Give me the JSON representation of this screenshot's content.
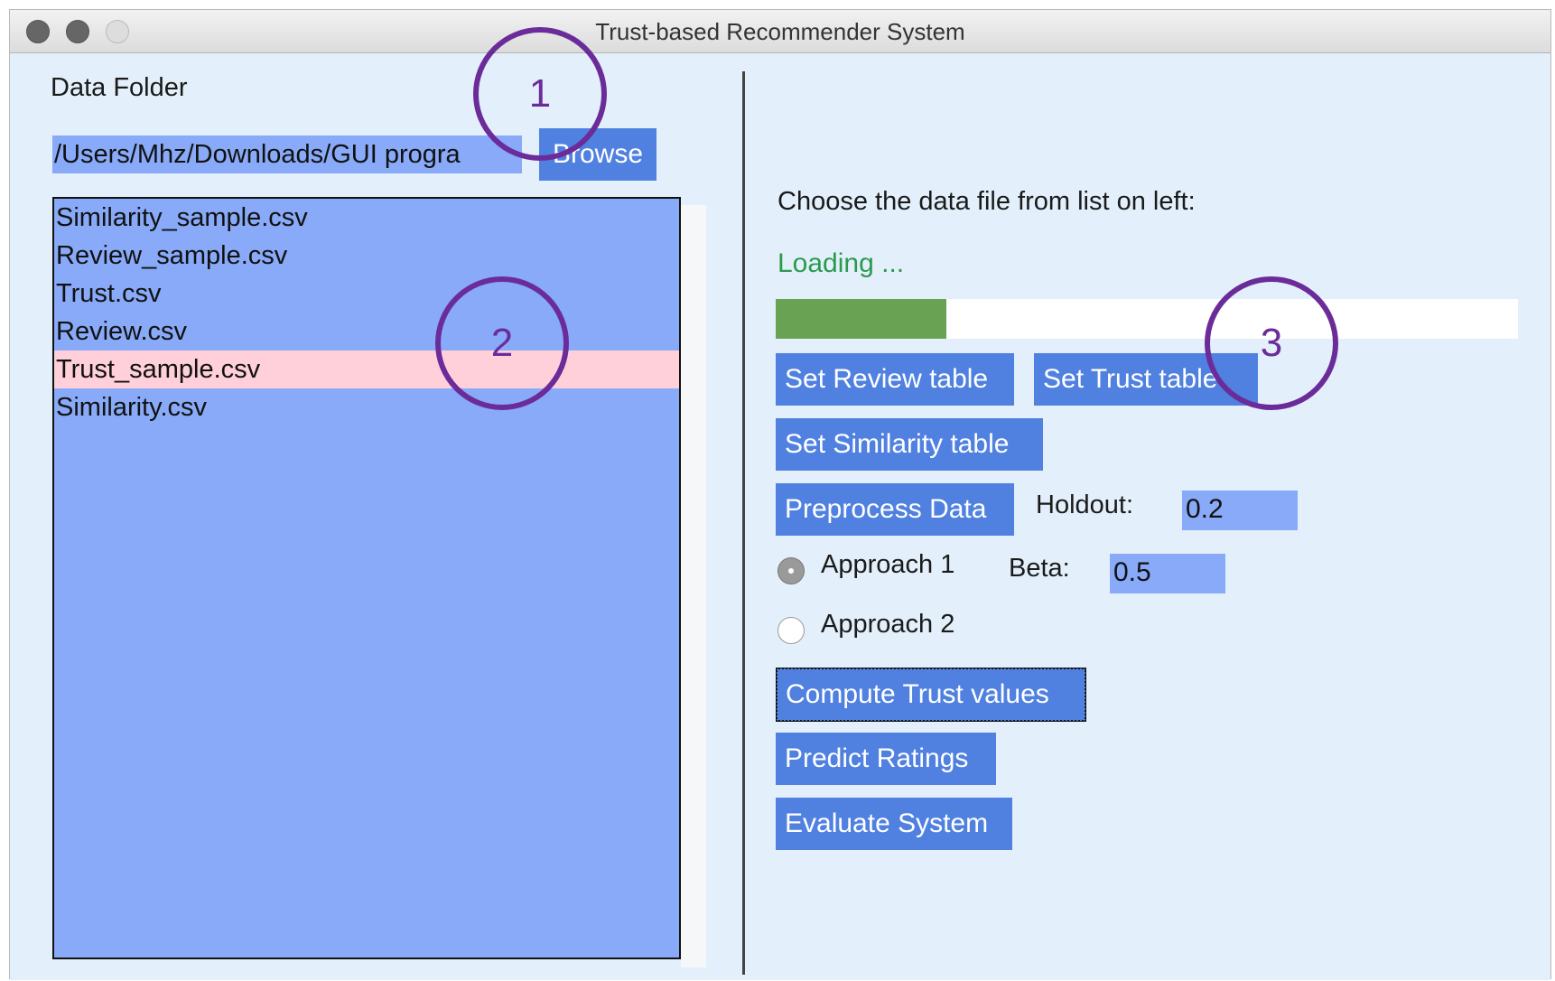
{
  "window": {
    "title": "Trust-based Recommender System"
  },
  "left_panel": {
    "data_folder_label": "Data Folder",
    "path_value": "/Users/Mhz/Downloads/GUI progra",
    "browse_label": "Browse",
    "files": [
      "Similarity_sample.csv",
      "Review_sample.csv",
      "Trust.csv",
      "Review.csv",
      "Trust_sample.csv",
      "Similarity.csv"
    ],
    "selected_file": "Trust_sample.csv"
  },
  "right_panel": {
    "instruction": "Choose the data file from list on left:",
    "status": "Loading ...",
    "progress": 0.23,
    "set_review_label": "Set Review table",
    "set_trust_label": "Set Trust table",
    "set_similarity_label": "Set Similarity table",
    "preprocess_label": "Preprocess Data",
    "holdout_label": "Holdout:",
    "holdout_value": "0.2",
    "approach1_label": "Approach 1",
    "approach2_label": "Approach 2",
    "approach_selected": "Approach 1",
    "beta_label": "Beta:",
    "beta_value": "0.5",
    "compute_label": "Compute Trust values",
    "predict_label": "Predict Ratings",
    "evaluate_label": "Evaluate System"
  },
  "annotations": [
    "1",
    "2",
    "3"
  ],
  "colors": {
    "window_bg": "#e3f0fb",
    "field_bg": "#88aaf8",
    "button_bg": "#5081e0",
    "selected_row": "#ffd0da",
    "progress_fill": "#69a253",
    "status_text": "#2a9a4e",
    "annotation": "#6b2c9a"
  }
}
